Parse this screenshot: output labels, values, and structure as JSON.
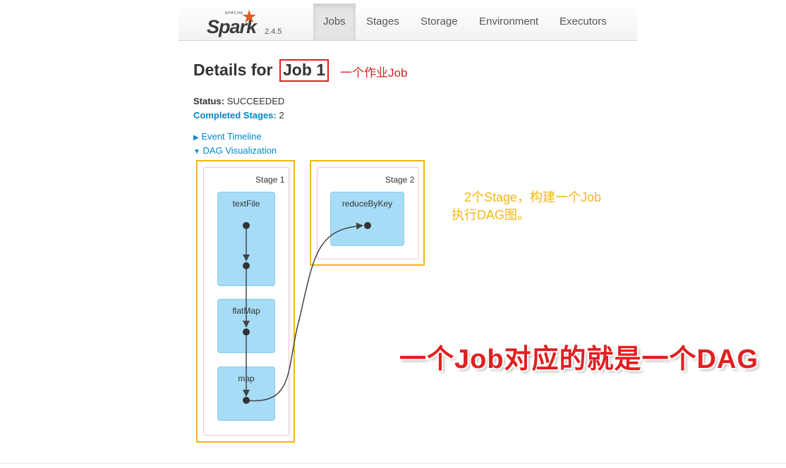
{
  "navbar": {
    "brand_apache": "APACHE",
    "brand_name": "Spark",
    "version": "2.4.5",
    "tabs": [
      {
        "label": "Jobs",
        "active": true
      },
      {
        "label": "Stages",
        "active": false
      },
      {
        "label": "Storage",
        "active": false
      },
      {
        "label": "Environment",
        "active": false
      },
      {
        "label": "Executors",
        "active": false
      }
    ]
  },
  "page": {
    "title_prefix": "Details for",
    "title_job": "Job 1",
    "status_label": "Status:",
    "status_value": "SUCCEEDED",
    "completed_label": "Completed Stages:",
    "completed_value": "2",
    "event_timeline": "Event Timeline",
    "dag_visualization": "DAG Visualization"
  },
  "dag": {
    "stages": [
      {
        "label": "Stage 1",
        "rdds": [
          "textFile",
          "flatMap",
          "map"
        ]
      },
      {
        "label": "Stage 2",
        "rdds": [
          "reduceByKey"
        ]
      }
    ]
  },
  "annotations": {
    "job_note": "一个作业Job",
    "stage_note_line1": "2个Stage，构建一个Job",
    "stage_note_line2": "执行DAG图。",
    "big_note": "一个Job对应的就是一个DAG"
  },
  "colors": {
    "annotation_red": "#e02020",
    "annotation_yellow": "#f3b617",
    "link_blue": "#0088cc",
    "rdd_fill": "#a6dcf6",
    "spark_orange": "#e25a1c"
  }
}
